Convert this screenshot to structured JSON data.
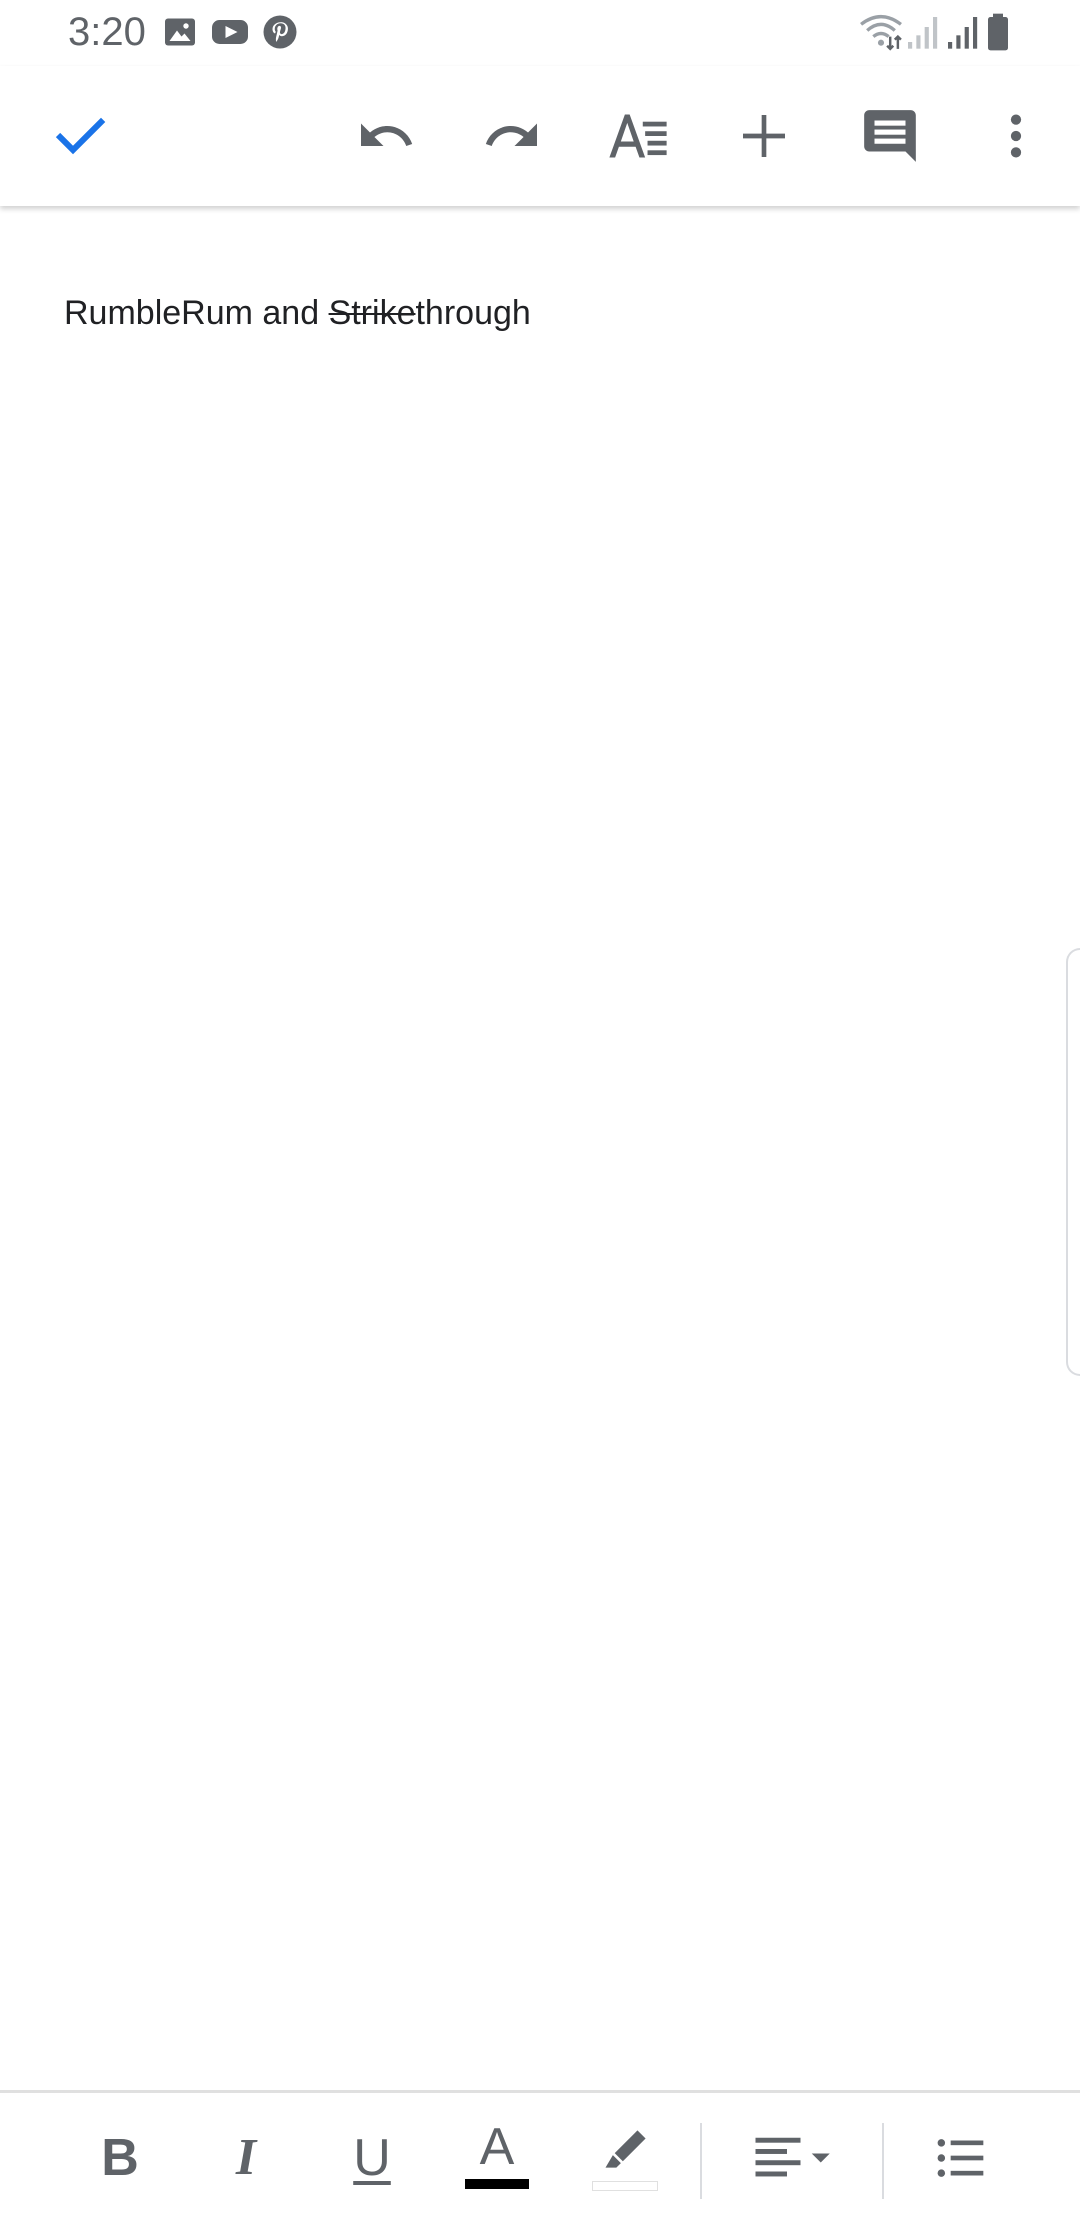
{
  "status_bar": {
    "time": "3:20",
    "left_icons": [
      "image-icon",
      "youtube-icon",
      "pinterest-icon"
    ],
    "right_icons": [
      "wifi-icon",
      "signal-icon-1",
      "signal-icon-2",
      "battery-icon"
    ]
  },
  "toolbar": {
    "icons": [
      "check-icon",
      "undo-icon",
      "redo-icon",
      "text-format-icon",
      "insert-plus-icon",
      "comment-icon",
      "more-vert-icon"
    ]
  },
  "document": {
    "text_before": "RumbleRum and ",
    "text_strike": "Strike",
    "text_after": "through"
  },
  "format_bar": {
    "bold_label": "B",
    "italic_label": "I",
    "underline_label": "U",
    "text_color_label": "A",
    "text_color": "#000000",
    "icons": [
      "highlight-icon",
      "align-left-icon",
      "bullet-list-icon"
    ]
  },
  "colors": {
    "accent": "#1a73e8",
    "icon_gray": "#5f6368",
    "text": "#202124"
  }
}
